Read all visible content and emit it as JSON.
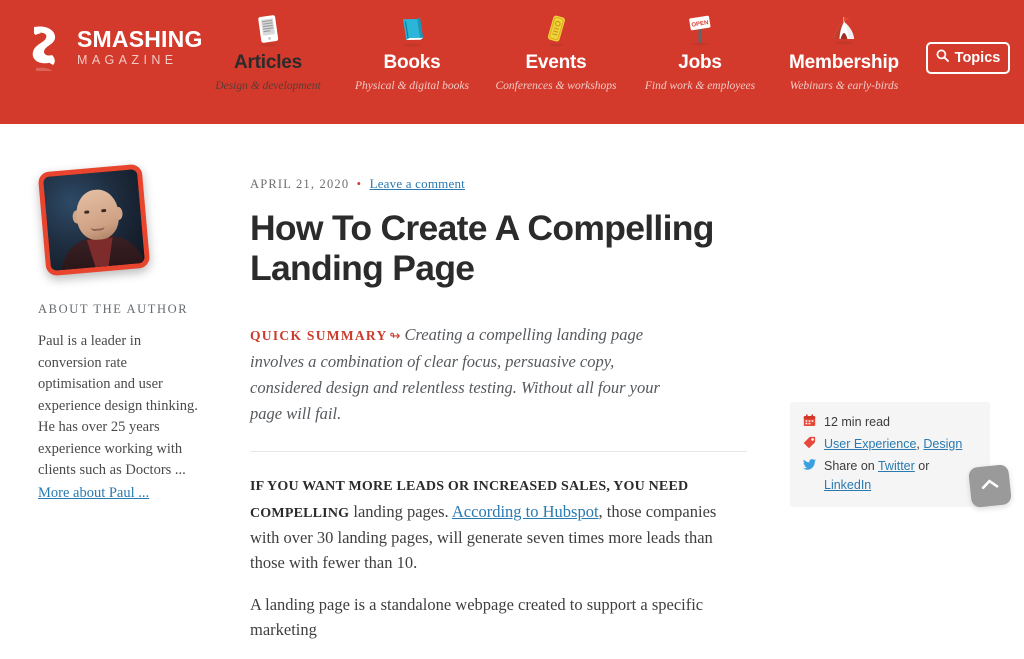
{
  "colors": {
    "brand_red": "#d33a2c",
    "link_blue": "#2a7ab0",
    "accent_red": "#cc3b2b",
    "meta_box_bg": "#f5f5f5",
    "text_dark": "#2b2b2b"
  },
  "header": {
    "logo": {
      "icon": "smashing-cat-logo",
      "title": "SMASHING",
      "subtitle": "MAGAZINE"
    },
    "nav": [
      {
        "icon": "tablet-article-icon",
        "label": "Articles",
        "sub": "Design & development",
        "style": "dark"
      },
      {
        "icon": "book-icon",
        "label": "Books",
        "sub": "Physical & digital books",
        "style": "light"
      },
      {
        "icon": "ticket-icon",
        "label": "Events",
        "sub": "Conferences & workshops",
        "style": "light"
      },
      {
        "icon": "open-sign-icon",
        "label": "Jobs",
        "sub": "Find work & employees",
        "style": "light"
      },
      {
        "icon": "circus-tent-icon",
        "label": "Membership",
        "sub": "Webinars & early-birds",
        "style": "light"
      }
    ],
    "topics_button": {
      "icon": "search-icon",
      "label": "Topics"
    }
  },
  "sidebar": {
    "avatar_alt": "author-portrait",
    "about_heading": "ABOUT THE AUTHOR",
    "bio": "Paul is a leader in conversion rate optimisation and user experience design thinking. He has over 25 years experience working with clients such as Doctors ...",
    "more_link": "More about Paul ..."
  },
  "article": {
    "date": "APRIL 21, 2020",
    "separator": "•",
    "comment_link": "Leave a comment",
    "title": "How To Create A Compelling Landing Page",
    "summary_label": "QUICK SUMMARY",
    "summary_arrow": "↬",
    "summary_text": "Creating a compelling landing page involves a combination of clear focus, persuasive copy, considered design and relentless testing. Without all four your page will fail.",
    "paragraph1": {
      "lead": "If you want more leads or increased sales, you need compelling",
      "rest_before_link": " landing pages. ",
      "link": "According to Hubspot",
      "rest_after_link": ", those companies with over 30 landing pages, will generate seven times more leads than those with fewer than 10."
    },
    "paragraph2": "A landing page is a standalone webpage created to support a specific marketing"
  },
  "meta_box": {
    "read_time": {
      "icon": "calendar-icon",
      "text": "12 min read"
    },
    "tags": {
      "icon": "tag-icon",
      "items": [
        "User Experience",
        "Design"
      ],
      "separator": ", "
    },
    "share": {
      "icon": "twitter-icon",
      "prefix": "Share on ",
      "first": "Twitter",
      "conjunction": " or ",
      "second": "LinkedIn"
    }
  },
  "back_to_top": {
    "icon": "chevron-up-icon",
    "label": "Back to top"
  }
}
